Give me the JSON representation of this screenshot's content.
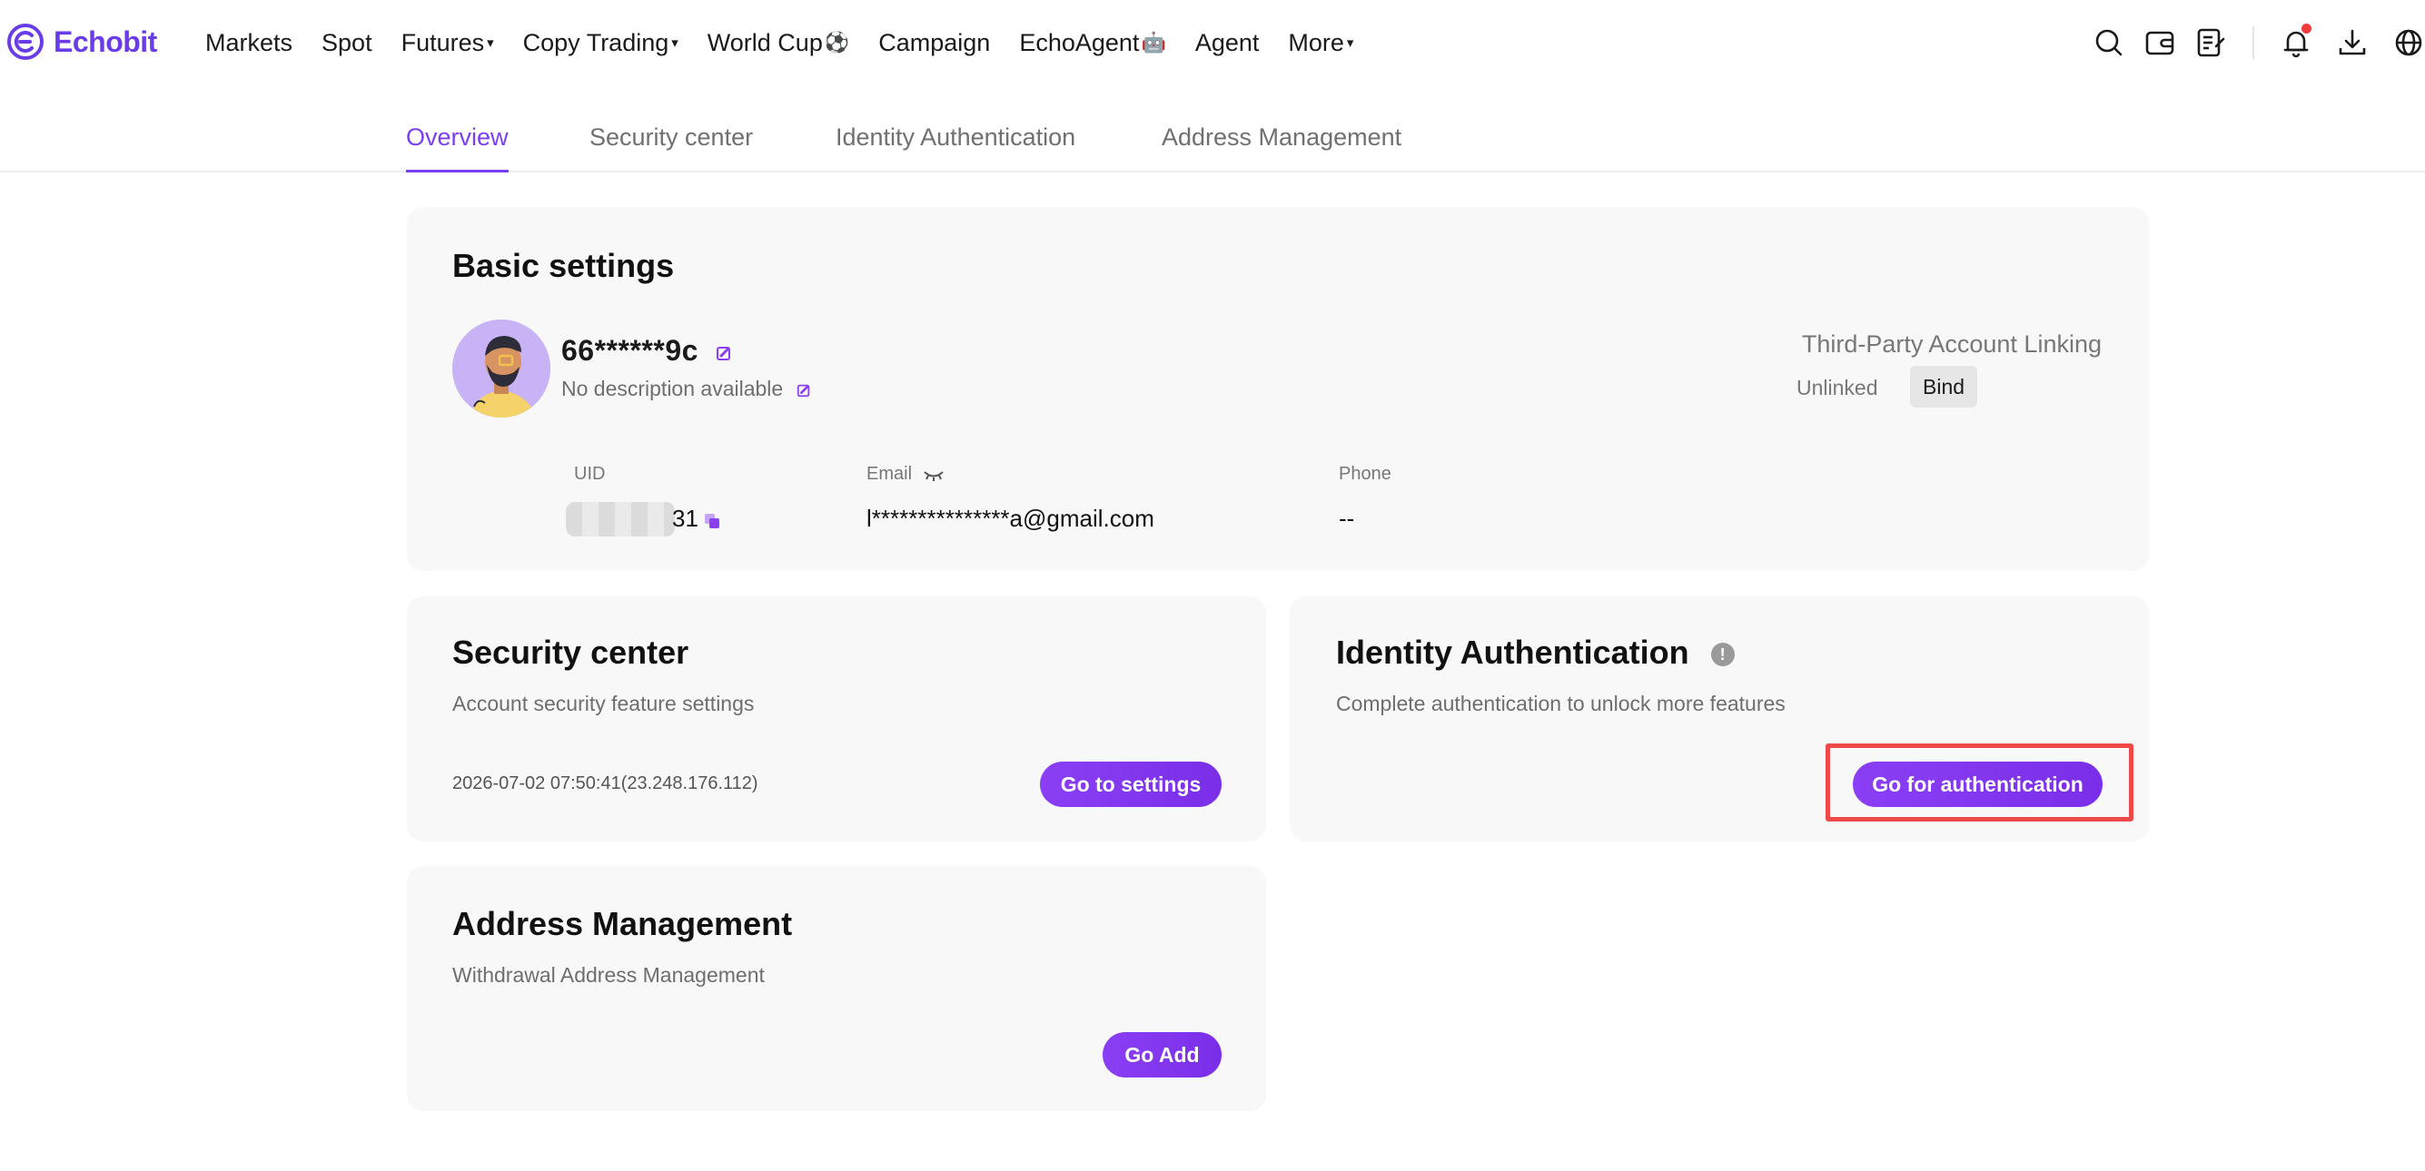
{
  "brand": {
    "name": "Echobit",
    "accent": "#7b3ff2",
    "highlight": "#ee4a4a"
  },
  "nav": {
    "markets": "Markets",
    "spot": "Spot",
    "futures": "Futures",
    "copy_trading": "Copy Trading",
    "world_cup": "World Cup",
    "world_cup_emoji": "⚽",
    "campaign": "Campaign",
    "echo_agent": "EchoAgent",
    "echo_agent_emoji": "🤖",
    "agent": "Agent",
    "more": "More",
    "caret": "▾"
  },
  "header_icons": [
    "search-icon",
    "wallet-icon",
    "orders-icon",
    "bell-icon",
    "download-icon",
    "globe-icon"
  ],
  "tabs": {
    "overview": "Overview",
    "security": "Security center",
    "identity": "Identity Authentication",
    "address": "Address Management",
    "active": "overview"
  },
  "basic": {
    "title": "Basic settings",
    "username": "66******9c",
    "description": "No description available",
    "third_party_title": "Third-Party Account Linking",
    "third_party_status": "Unlinked",
    "bind_label": "Bind",
    "uid_label": "UID",
    "uid_value": "31",
    "email_label": "Email",
    "email_value": "l***************a@gmail.com",
    "phone_label": "Phone",
    "phone_value": "--"
  },
  "security": {
    "title": "Security center",
    "subtitle": "Account security feature settings",
    "last_login": "2026-07-02 07:50:41(23.248.176.112)",
    "button": "Go to settings"
  },
  "identity": {
    "title": "Identity Authentication",
    "info_glyph": "!",
    "subtitle": "Complete authentication to unlock more features",
    "button": "Go for authentication"
  },
  "address": {
    "title": "Address Management",
    "subtitle": "Withdrawal Address Management",
    "button": "Go Add"
  }
}
